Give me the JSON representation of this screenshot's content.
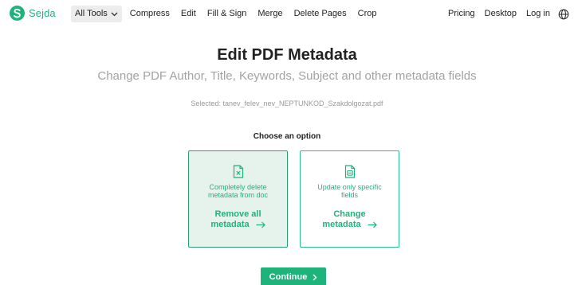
{
  "brand": {
    "name": "Sejda",
    "color": "#1fb37c"
  },
  "nav": {
    "all_tools": "All Tools",
    "links": [
      "Compress",
      "Edit",
      "Fill & Sign",
      "Merge",
      "Delete Pages",
      "Crop"
    ],
    "right": [
      "Pricing",
      "Desktop",
      "Log in"
    ],
    "globe_icon": "globe-icon"
  },
  "page": {
    "title": "Edit PDF Metadata",
    "subtitle": "Change PDF Author, Title, Keywords, Subject and other metadata fields",
    "selected": "Selected: tanev_felev_nev_NEPTUNKOD_Szakdolgozat.pdf",
    "choose": "Choose an option"
  },
  "options": [
    {
      "icon": "file-delete-icon",
      "desc": "Completely delete metadata from doc",
      "title_line1": "Remove all",
      "title_line2": "metadata",
      "selected": true
    },
    {
      "icon": "file-edit-icon",
      "desc": "Update only specific fields",
      "title_line1": "Change",
      "title_line2": "metadata",
      "selected": false
    }
  ],
  "continue_label": "Continue"
}
